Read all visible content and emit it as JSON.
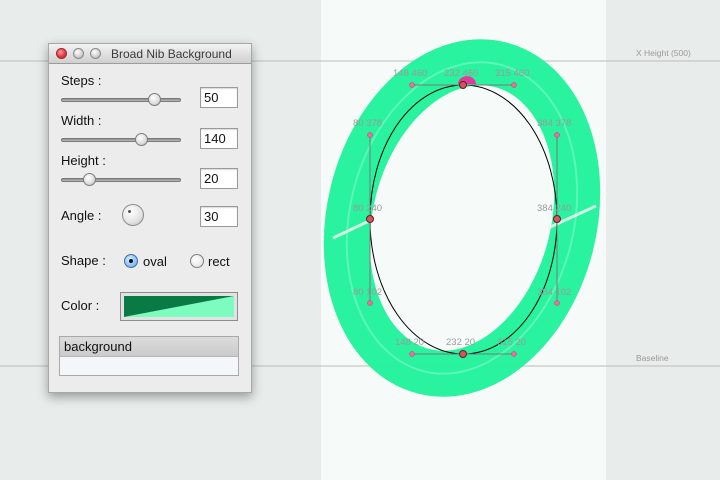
{
  "window": {
    "title": "Broad Nib Background"
  },
  "guides": {
    "x_height_label": "X Height (500)",
    "baseline_label": "Baseline"
  },
  "glyph": {
    "stroke_color": "#1ef29a",
    "points": [
      {
        "id": "top-left-handle",
        "label": "148  460"
      },
      {
        "id": "top",
        "label": "232  460"
      },
      {
        "id": "top-right-handle",
        "label": "315  460"
      },
      {
        "id": "left-upper-handle",
        "label": "80  378"
      },
      {
        "id": "right-upper-handle",
        "label": "384  378"
      },
      {
        "id": "left",
        "label": "80  240"
      },
      {
        "id": "right",
        "label": "384  240"
      },
      {
        "id": "left-lower-handle",
        "label": "80  102"
      },
      {
        "id": "right-lower-handle",
        "label": "384  102"
      },
      {
        "id": "bottom-left-handle",
        "label": "148  20"
      },
      {
        "id": "bottom",
        "label": "232  20"
      },
      {
        "id": "bottom-right-handle",
        "label": "315  20"
      }
    ]
  },
  "panel": {
    "steps": {
      "label": "Steps :",
      "value": "50",
      "level": 0.8
    },
    "width": {
      "label": "Width :",
      "value": "140",
      "level": 0.68
    },
    "height": {
      "label": "Height :",
      "value": "20",
      "level": 0.2
    },
    "angle": {
      "label": "Angle :",
      "value": "30"
    },
    "shape": {
      "label": "Shape :",
      "options": [
        "oval",
        "rect"
      ],
      "selected": "oval"
    },
    "color": {
      "label": "Color :",
      "dark": "#0a7a45",
      "light": "#7dfcc0"
    },
    "layers": [
      "background"
    ]
  }
}
